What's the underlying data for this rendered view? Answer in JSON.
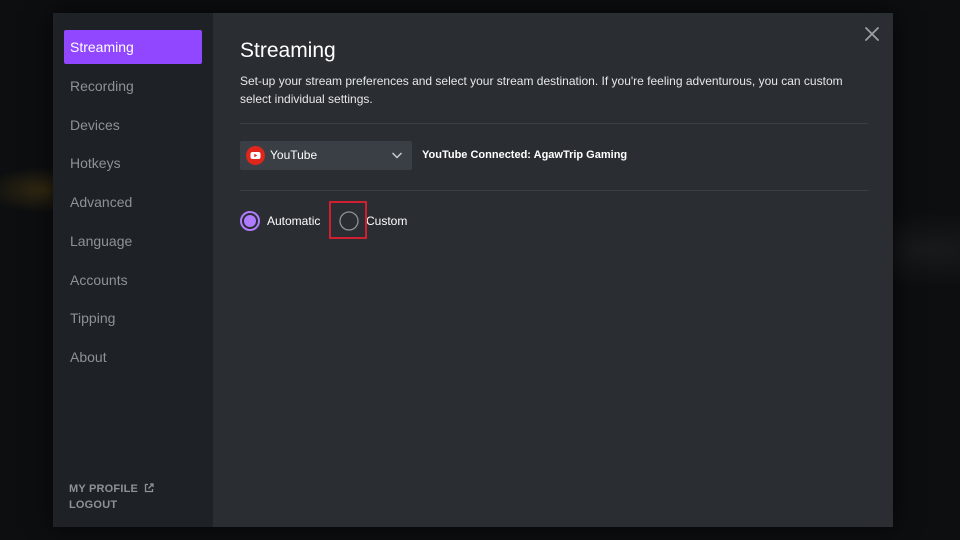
{
  "sidebar": {
    "items": [
      {
        "label": "Streaming",
        "active": true
      },
      {
        "label": "Recording",
        "active": false
      },
      {
        "label": "Devices",
        "active": false
      },
      {
        "label": "Hotkeys",
        "active": false
      },
      {
        "label": "Advanced",
        "active": false
      },
      {
        "label": "Language",
        "active": false
      },
      {
        "label": "Accounts",
        "active": false
      },
      {
        "label": "Tipping",
        "active": false
      },
      {
        "label": "About",
        "active": false
      }
    ],
    "my_profile_label": "MY PROFILE",
    "logout_label": "LOGOUT"
  },
  "main": {
    "title": "Streaming",
    "description": "Set-up your stream preferences and select your stream destination. If you're feeling adventurous, you can custom select individual settings.",
    "platform_select": {
      "selected": "YouTube",
      "icon": "youtube-icon"
    },
    "connection_status": "YouTube Connected: AgawTrip Gaming",
    "mode_options": [
      {
        "label": "Automatic",
        "selected": true
      },
      {
        "label": "Custom",
        "selected": false
      }
    ]
  },
  "colors": {
    "accent": "#9147ff",
    "youtube_red": "#e0251b",
    "highlight": "#d01f2e",
    "modal_bg": "#2a2e33",
    "sidebar_bg": "#1e2125"
  }
}
